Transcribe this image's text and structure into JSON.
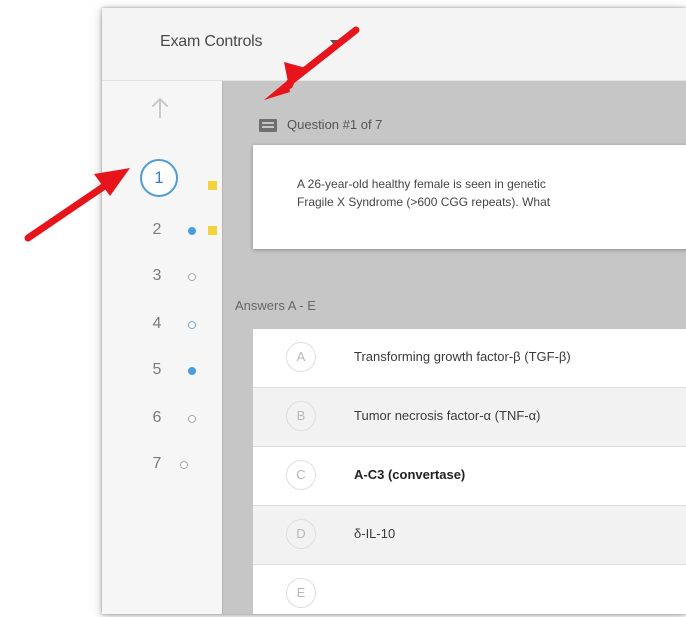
{
  "header": {
    "exam_controls_label": "Exam Controls"
  },
  "sidebar": {
    "up_icon": "up-arrow-icon",
    "questions": [
      {
        "number": "1",
        "status": "current",
        "flagged": true
      },
      {
        "number": "2",
        "status": "answered",
        "flagged": true
      },
      {
        "number": "3",
        "status": "unanswered",
        "flagged": false
      },
      {
        "number": "4",
        "status": "unanswered-blue",
        "flagged": false
      },
      {
        "number": "5",
        "status": "answered",
        "flagged": false
      },
      {
        "number": "6",
        "status": "unanswered",
        "flagged": false
      },
      {
        "number": "7",
        "status": "unanswered",
        "flagged": false
      }
    ]
  },
  "question": {
    "title": "Question #1 of 7",
    "text_line1": "A 26-year-old healthy female is seen in genetic",
    "text_line2": "Fragile X Syndrome (>600 CGG repeats). What"
  },
  "answers": {
    "label": "Answers A - E",
    "items": [
      {
        "letter": "A",
        "text": "Transforming growth factor-β (TGF-β)",
        "bold": false
      },
      {
        "letter": "B",
        "text": "Tumor necrosis factor-α (TNF-α)",
        "bold": false
      },
      {
        "letter": "C",
        "text": "A-C3 (convertase)",
        "bold": true
      },
      {
        "letter": "D",
        "text": "δ-IL-10",
        "bold": false
      },
      {
        "letter": "E",
        "text": "",
        "bold": false
      }
    ]
  },
  "colors": {
    "accent_blue": "#4a9ee0",
    "flag_yellow": "#f5d33b",
    "annotation_red": "#e8141b"
  }
}
